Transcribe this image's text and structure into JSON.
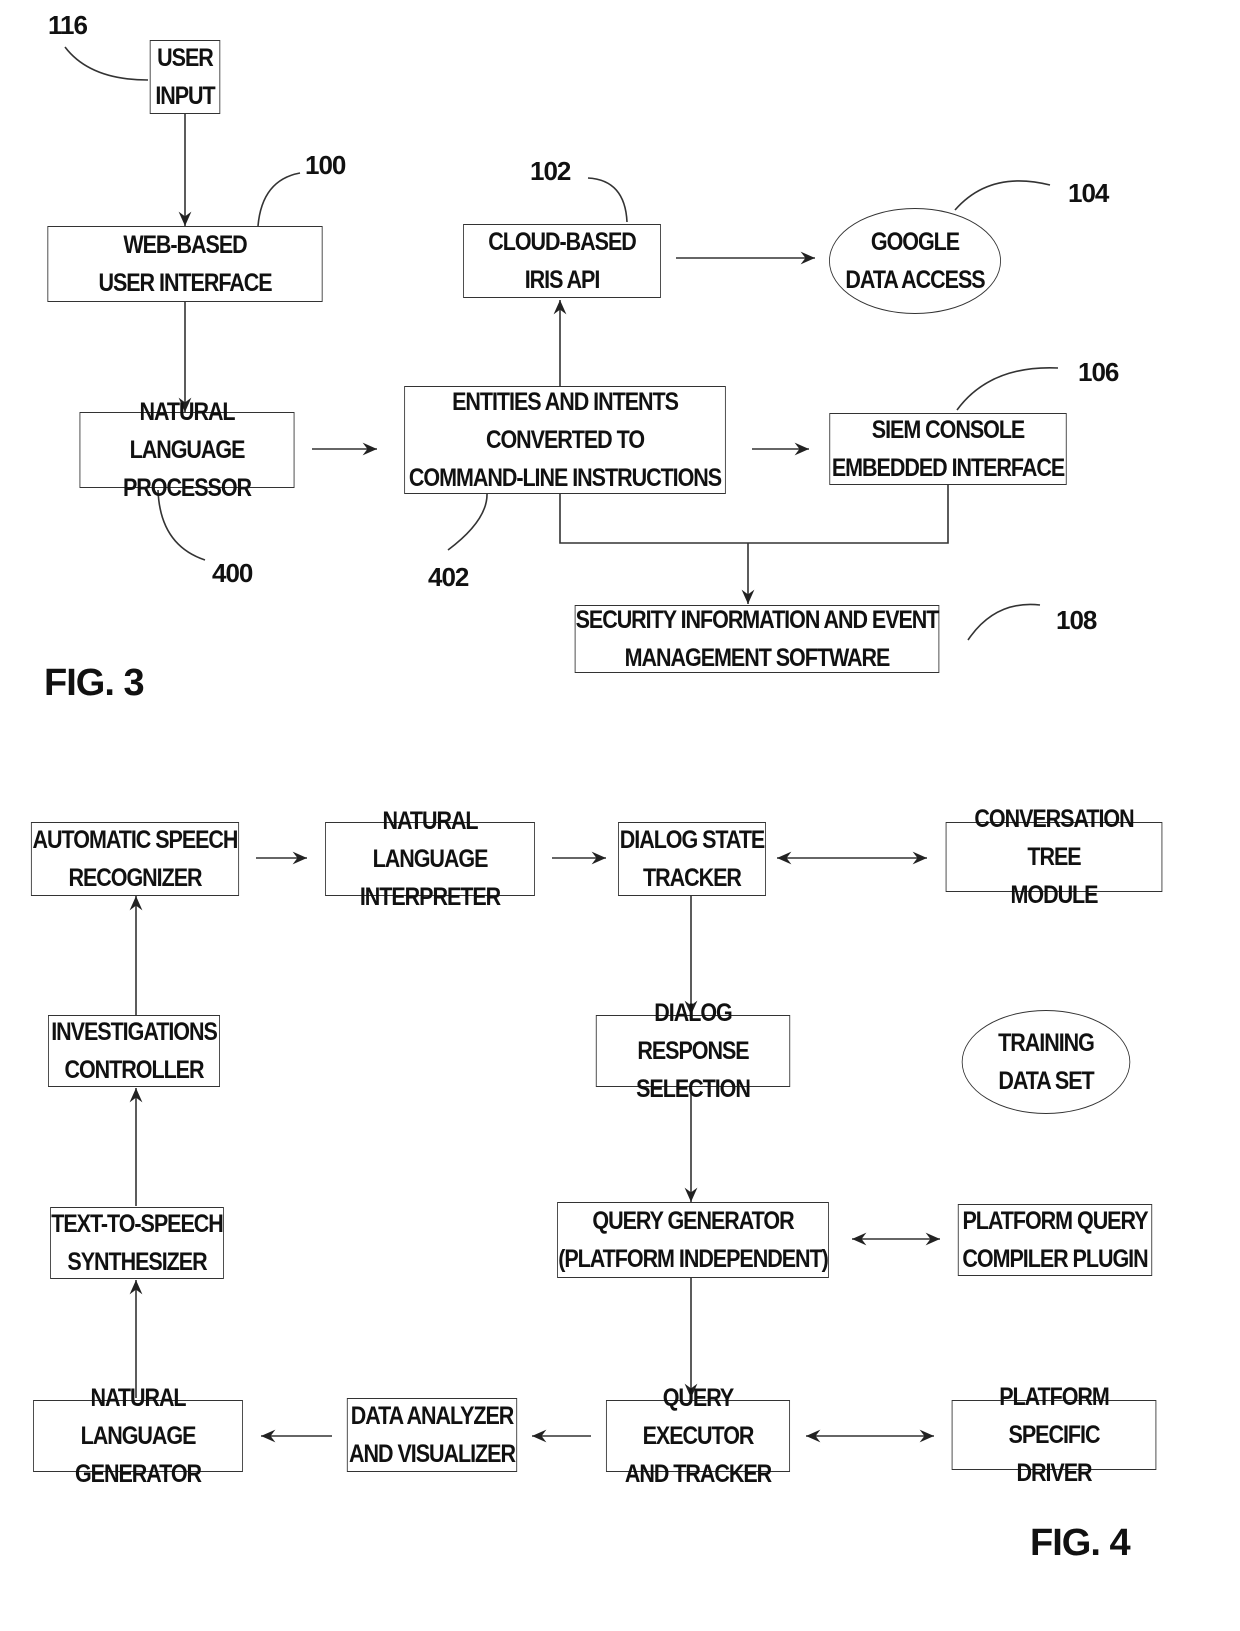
{
  "fig3": {
    "caption": "FIG. 3",
    "nodes": {
      "user_input": {
        "ref": "116",
        "lines": [
          "USER",
          "INPUT"
        ]
      },
      "web_ui": {
        "ref": "100",
        "lines": [
          "WEB-BASED",
          "USER INTERFACE"
        ]
      },
      "nlp": {
        "ref": "400",
        "lines": [
          "NATURAL LANGUAGE",
          "PROCESSOR"
        ]
      },
      "entities": {
        "ref": "402",
        "lines": [
          "ENTITIES AND INTENTS",
          "CONVERTED TO",
          "COMMAND-LINE INSTRUCTIONS"
        ]
      },
      "iris_api": {
        "ref": "102",
        "lines": [
          "CLOUD-BASED",
          "IRIS API"
        ]
      },
      "google": {
        "ref": "104",
        "lines": [
          "GOOGLE",
          "DATA ACCESS"
        ]
      },
      "siem_console": {
        "ref": "106",
        "lines": [
          "SIEM CONSOLE",
          "EMBEDDED INTERFACE"
        ]
      },
      "siem_software": {
        "ref": "108",
        "lines": [
          "SECURITY INFORMATION AND EVENT",
          "MANAGEMENT SOFTWARE"
        ]
      }
    }
  },
  "fig4": {
    "caption": "FIG. 4",
    "nodes": {
      "asr": {
        "lines": [
          "AUTOMATIC SPEECH",
          "RECOGNIZER"
        ]
      },
      "nli": {
        "lines": [
          "NATURAL LANGUAGE",
          "INTERPRETER"
        ]
      },
      "dst": {
        "lines": [
          "DIALOG STATE",
          "TRACKER"
        ]
      },
      "conv_tree": {
        "lines": [
          "CONVERSATION TREE",
          "MODULE"
        ]
      },
      "inv_ctrl": {
        "lines": [
          "INVESTIGATIONS",
          "CONTROLLER"
        ]
      },
      "drs": {
        "lines": [
          "DIALOG RESPONSE",
          "SELECTION"
        ]
      },
      "training": {
        "lines": [
          "TRAINING",
          "DATA SET"
        ]
      },
      "tts": {
        "lines": [
          "TEXT-TO-SPEECH",
          "SYNTHESIZER"
        ]
      },
      "query_gen": {
        "lines": [
          "QUERY GENERATOR",
          "(PLATFORM INDEPENDENT)"
        ]
      },
      "pqc": {
        "lines": [
          "PLATFORM QUERY",
          "COMPILER PLUGIN"
        ]
      },
      "nlg": {
        "lines": [
          "NATURAL LANGUAGE",
          "GENERATOR"
        ]
      },
      "dav": {
        "lines": [
          "DATA ANALYZER",
          "AND VISUALIZER"
        ]
      },
      "qet": {
        "lines": [
          "QUERY EXECUTOR",
          "AND TRACKER"
        ]
      },
      "psd": {
        "lines": [
          "PLATFORM SPECIFIC",
          "DRIVER"
        ]
      }
    }
  }
}
